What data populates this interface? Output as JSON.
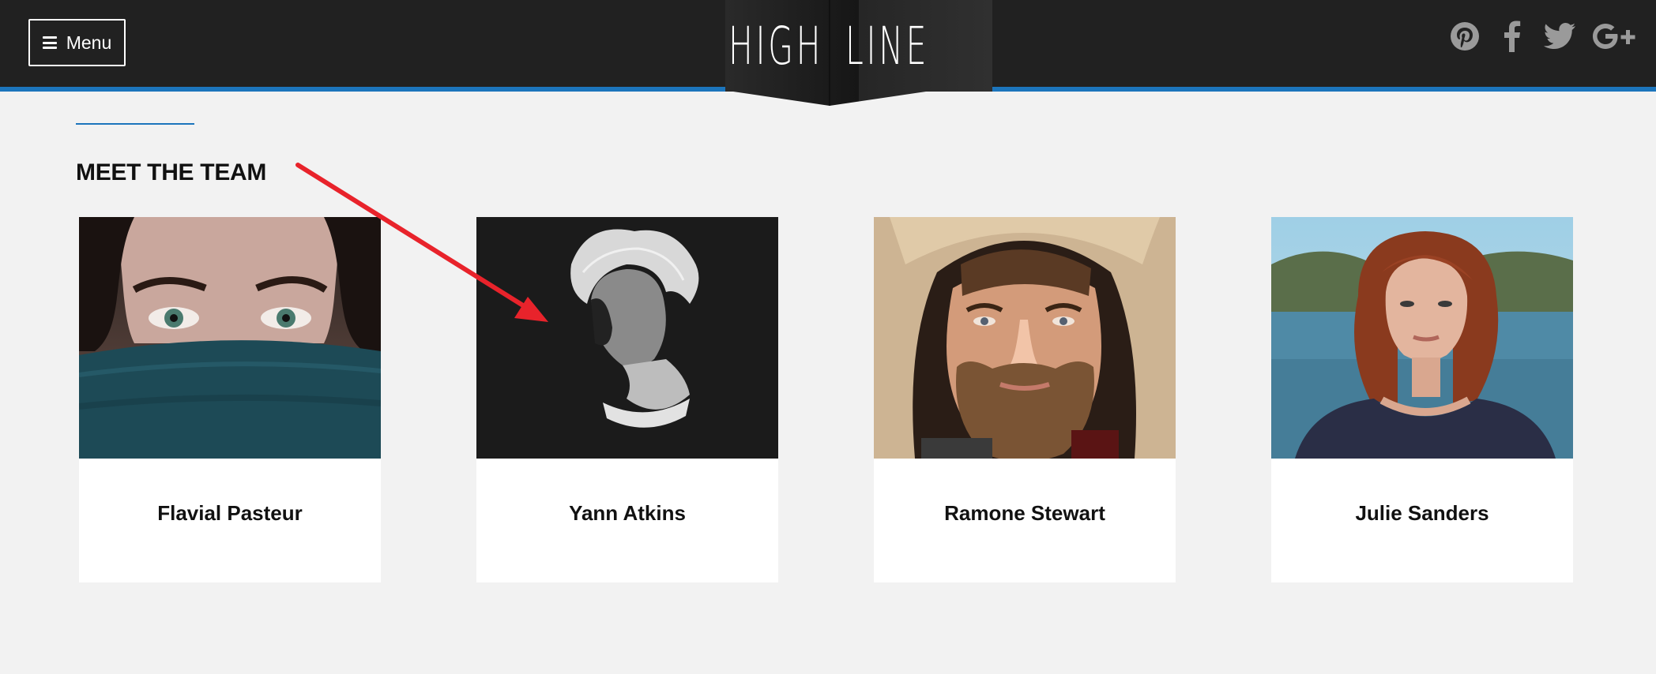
{
  "header": {
    "menu_label": "Menu",
    "logo_left": "HIGH",
    "logo_right": "LINE",
    "social_icons": [
      "pinterest-icon",
      "facebook-icon",
      "twitter-icon",
      "google-plus-icon"
    ]
  },
  "section": {
    "title": "MEET THE TEAM"
  },
  "team": [
    {
      "name": "Flavial Pasteur"
    },
    {
      "name": "Yann Atkins"
    },
    {
      "name": "Ramone Stewart"
    },
    {
      "name": "Julie Sanders"
    }
  ],
  "colors": {
    "header_bg": "#212121",
    "accent": "#1c75bc",
    "page_bg": "#f2f2f2",
    "annotation_arrow": "#e8232b"
  }
}
